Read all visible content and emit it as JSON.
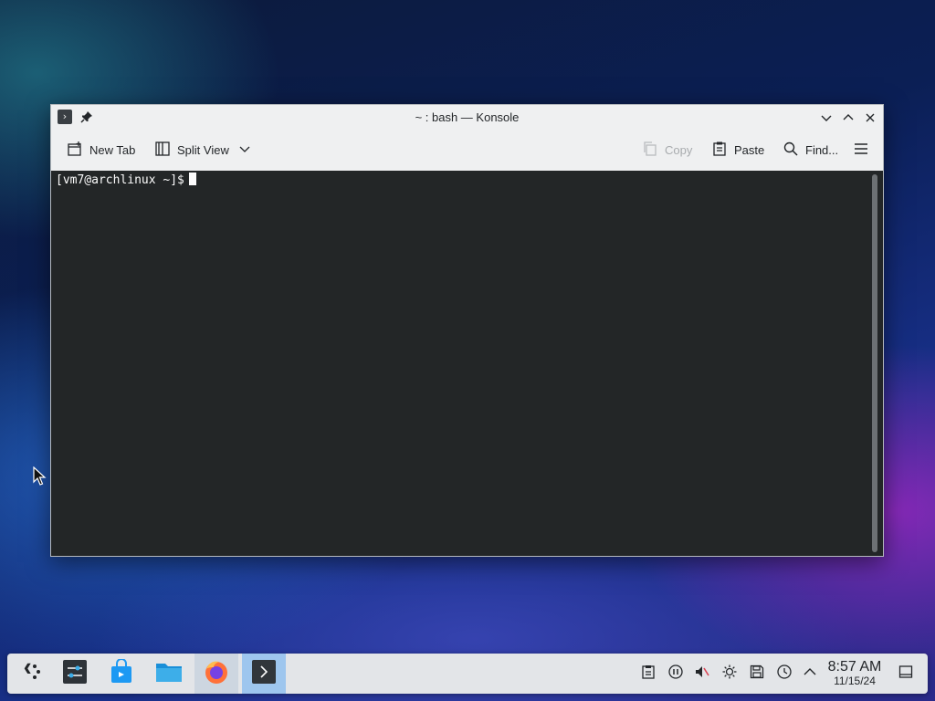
{
  "window": {
    "title": "~ : bash — Konsole",
    "app_icon_glyph": "›"
  },
  "toolbar": {
    "new_tab": "New Tab",
    "split_view": "Split View",
    "copy": "Copy",
    "paste": "Paste",
    "find": "Find..."
  },
  "terminal": {
    "prompt": "[vm7@archlinux ~]$"
  },
  "taskbar": {
    "tasks": [
      {
        "name": "application-launcher",
        "icon": "launcher-icon"
      },
      {
        "name": "system-settings",
        "icon": "settings-icon"
      },
      {
        "name": "discover",
        "icon": "store-icon"
      },
      {
        "name": "dolphin",
        "icon": "folder-icon"
      },
      {
        "name": "firefox",
        "icon": "firefox-icon"
      },
      {
        "name": "konsole",
        "icon": "terminal-icon"
      }
    ],
    "tray": [
      "clipboard-icon",
      "media-pause-icon",
      "volume-muted-icon",
      "brightness-icon",
      "storage-icon",
      "update-icon",
      "chevron-up-icon"
    ],
    "clock": {
      "time": "8:57 AM",
      "date": "11/15/24"
    }
  },
  "colors": {
    "terminal_bg": "#232627",
    "terminal_fg": "#fcfcfc",
    "window_bg": "#eff0f1",
    "active_task": "#9ec6ee"
  }
}
